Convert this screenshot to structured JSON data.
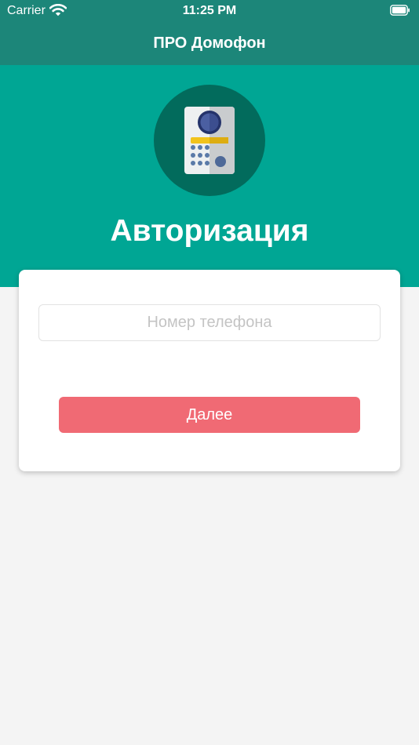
{
  "status_bar": {
    "carrier": "Carrier",
    "time": "11:25 PM"
  },
  "nav": {
    "title": "ПРО Домофон"
  },
  "hero": {
    "title": "Авторизация",
    "logo_icon": "intercom-panel-icon"
  },
  "form": {
    "phone_placeholder": "Номер телефона",
    "phone_value": "",
    "next_label": "Далее"
  },
  "colors": {
    "header": "#1c8679",
    "hero": "#00a694",
    "logo_circle": "#026b5c",
    "button": "#f06a74",
    "background": "#f4f4f4"
  }
}
